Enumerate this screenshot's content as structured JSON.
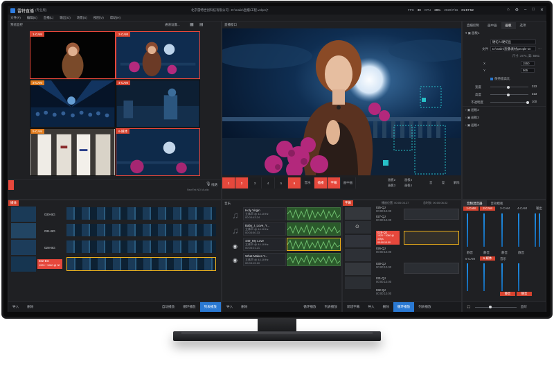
{
  "app": {
    "name": "雷特直播",
    "edition": "(专业版)",
    "doc_title": "北京雷特世创科技有限公司 - D:\\malin\\直播\\工程.velpro]*"
  },
  "stats": {
    "fps_label": "FPS",
    "fps": "30",
    "cpu_label": "CPU",
    "cpu": "29%",
    "date": "2020/7/16",
    "time": "01:57:52"
  },
  "menu": [
    "文件(F)",
    "编辑(E)",
    "直播(L)",
    "输出(O)",
    "场景(S)",
    "视图(V)",
    "帮助(H)"
  ],
  "preview": {
    "title": "预览监控",
    "tools": "通道设置...",
    "cells": [
      {
        "tag": "1-CAM"
      },
      {
        "tag": "2-CAM"
      },
      {
        "tag": "3-CAM"
      },
      {
        "tag": "4-CAM"
      },
      {
        "tag": "5-CAM"
      },
      {
        "tag": "6-媒体"
      }
    ],
    "mic_label": "线路",
    "audio_device": "NewTek NDI Audio"
  },
  "live": {
    "title": "直播窗口",
    "video_info": "1920 * 1080 @ 30fps  1920 * 1080 @ 30fps  48 KHz  48 KHz",
    "tools": [
      "通道切换",
      "插播",
      "录制",
      "推流"
    ],
    "switch_buttons": [
      "1",
      "2",
      "3",
      "4",
      "5",
      "6"
    ],
    "overlay_buttons": [
      "音乐",
      "插播",
      "字幕",
      "画中画",
      "画板2",
      "画板3",
      "画板4",
      "画板",
      "音",
      "复",
      "解除"
    ],
    "red_overlay": [
      "插播",
      "字幕"
    ]
  },
  "props": {
    "tabs": [
      "直播控制",
      "画中画",
      "画板",
      "选项"
    ],
    "active_tab": "画板",
    "board1": "画板1",
    "dropdown": "硬切入/硬切出",
    "file_label": "文件",
    "file_value": "D:\\malin\\直播\\素材\\people-on",
    "size_label": "尺寸: 3774, 高: 5661",
    "x_label": "X",
    "x": "1550",
    "y_label": "Y",
    "y": "565",
    "keep_ratio": "保持宽高比",
    "w_label": "宽度",
    "w": "313",
    "h_label": "高度",
    "h": "313",
    "opacity_label": "不透明度",
    "opacity": "100",
    "boards": [
      "画板2",
      "画板3",
      "画板4"
    ]
  },
  "media": {
    "title": "媒体",
    "items": [
      {
        "name": "030-BG"
      },
      {
        "name": "031-BG"
      },
      {
        "name": "028-BG"
      },
      {
        "name": "032-BG",
        "meta": "1920 * 1080 @ 30"
      }
    ],
    "buttons": [
      "导入",
      "删除",
      "自动播放",
      "循环播放",
      "列表播放"
    ]
  },
  "music": {
    "title": "音乐",
    "items": [
      {
        "title": "Holy Virgin",
        "meta": "立体声 @ 44.1KHz",
        "time": "00:03:43.24"
      },
      {
        "title": "Baby_I_Love_Y...",
        "meta": "立体声 @ 44.1KHz",
        "time": "00:03:50.33"
      },
      {
        "title": "449_My Love",
        "meta": "立体声 @ 44.1KHz",
        "time": "00:05:21.21"
      },
      {
        "title": "What Makes Y...",
        "meta": "立体声 @ 44.1KHz",
        "time": "00:03:15.10"
      }
    ],
    "buttons": [
      "导入",
      "删除",
      "循环播放",
      "列表播放"
    ]
  },
  "subtitle": {
    "title": "字幕",
    "time_left": "播放位置: 00:00:03.27",
    "time_right": "总时长: 00:00:06.02",
    "items": [
      {
        "name": "025-QJ",
        "meta": "1920 * 1080 @ 30fps",
        "time": "00:00:10.00"
      },
      {
        "name": "027-QJ",
        "meta": "1920 * 1080 @ 30fps",
        "time": "00:00:10.00"
      },
      {
        "name": "028-QJ",
        "meta": "1920 * 1080 @ 30fps",
        "time": "00:00:10.00"
      },
      {
        "name": "026-QJ",
        "meta": "1920 * 1080 @ 30fps",
        "time": "00:00:10.00"
      },
      {
        "name": "030-QJ",
        "meta": "1920 * 1080 @ 30fps",
        "time": "00:00:10.00"
      },
      {
        "name": "031-QJ",
        "meta": "1920 * 1080 @ 30fps",
        "time": "00:00:10.00"
      },
      {
        "name": "032-QJ",
        "meta": "1920 * 1080 @ 30fps",
        "time": "00:00:10.00"
      }
    ],
    "buttons": [
      "新建字幕",
      "导入",
      "删除",
      "循环播放",
      "列表播放"
    ]
  },
  "mixer": {
    "tabs": [
      "音频混音器",
      "音效模板"
    ],
    "channels_top": [
      "1-CAM",
      "2-CAM",
      "3-CAM",
      "4-CAM",
      "输出"
    ],
    "channels_bottom": [
      "5-CAM",
      "6-媒体",
      "音乐"
    ],
    "mute": "静音",
    "mute_label": "静音",
    "monitor": "监听"
  },
  "colors": {
    "accent": "#e6483c",
    "highlight": "#f0b21a",
    "blue": "#2a79d3"
  }
}
